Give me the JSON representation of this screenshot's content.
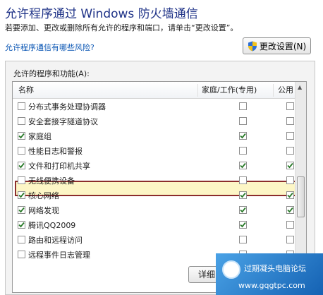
{
  "title": "允许程序通过 Windows 防火墙通信",
  "subtitle": "若要添加、更改或删除所有允许的程序和端口，请单击“更改设置”。",
  "risk_link": "允许程序通信有哪些风险?",
  "change_settings_button": "更改设置(N)",
  "panel": {
    "label": "允许的程序和功能(A):",
    "columns": {
      "name": "名称",
      "home_work": "家庭/工作(专用)",
      "public": "公用"
    }
  },
  "rows": [
    {
      "name": "分布式事务处理协调器",
      "enabled": false,
      "home": false,
      "public": false
    },
    {
      "name": "安全套接字隧道协议",
      "enabled": false,
      "home": false,
      "public": false
    },
    {
      "name": "家庭组",
      "enabled": true,
      "home": true,
      "public": false
    },
    {
      "name": "性能日志和警报",
      "enabled": false,
      "home": false,
      "public": false
    },
    {
      "name": "文件和打印机共享",
      "enabled": true,
      "home": true,
      "public": true
    },
    {
      "name": "无线便携设备",
      "enabled": false,
      "home": false,
      "public": false
    },
    {
      "name": "核心网络",
      "enabled": true,
      "home": true,
      "public": true
    },
    {
      "name": "网络发现",
      "enabled": true,
      "home": true,
      "public": true
    },
    {
      "name": "腾讯QQ2009",
      "enabled": true,
      "home": true,
      "public": false
    },
    {
      "name": "路由和远程访问",
      "enabled": false,
      "home": false,
      "public": false
    },
    {
      "name": "远程事件日志管理",
      "enabled": false,
      "home": false,
      "public": false
    }
  ],
  "highlighted_row": "文件和打印机共享",
  "details_button": "详细",
  "watermark": {
    "text": "过期凝头电脑论坛",
    "url": "www.gqgtpc.com"
  },
  "colors": {
    "title": "#1e3287",
    "link": "#0a56b4",
    "highlight_border": "#8c2d2d",
    "check": "#2a7a2a"
  }
}
